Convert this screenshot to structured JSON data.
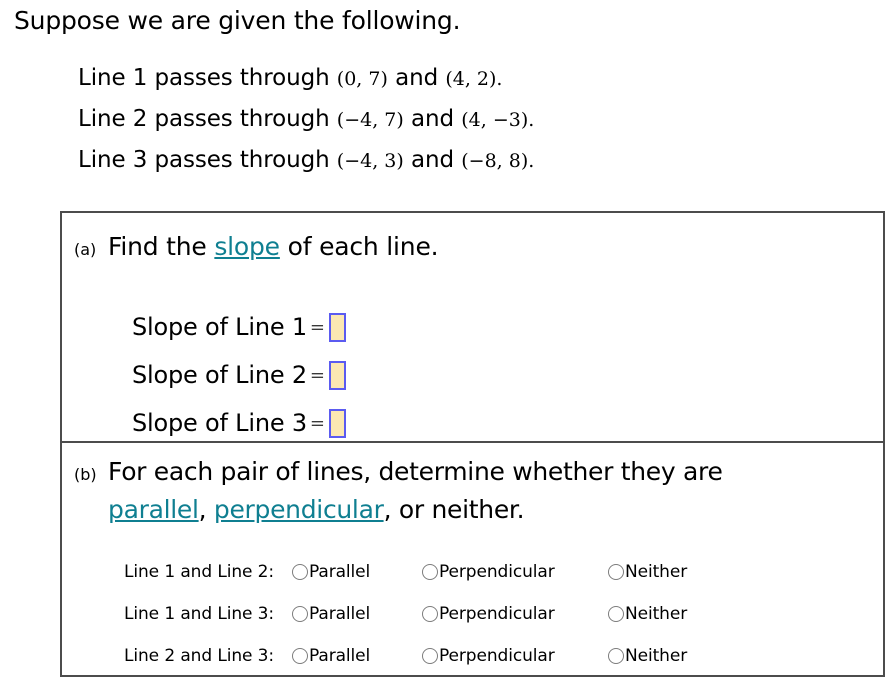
{
  "intro": {
    "text": "Suppose we are given the following."
  },
  "given": [
    {
      "prefix": "Line 1 passes through",
      "point1": "(0, 7)",
      "conjunction": "and",
      "point2": "(4, 2)",
      "period": "."
    },
    {
      "prefix": "Line 2 passes through",
      "point1": "(−4, 7)",
      "conjunction": "and",
      "point2": "(4, −3)",
      "period": "."
    },
    {
      "prefix": "Line 3 passes through",
      "point1": "(−4, 3)",
      "conjunction": "and",
      "point2": "(−8, 8)",
      "period": "."
    }
  ],
  "part_a": {
    "label": "(a)",
    "prompt_before": "Find the ",
    "prompt_link": "slope",
    "prompt_after": " of each line.",
    "equals": "=",
    "rows": [
      {
        "label": "Slope of Line 1",
        "value": ""
      },
      {
        "label": "Slope of Line 2",
        "value": ""
      },
      {
        "label": "Slope of Line 3",
        "value": ""
      }
    ]
  },
  "part_b": {
    "label": "(b)",
    "prompt_line1": "For each pair of lines, determine whether they are",
    "link_parallel": "parallel",
    "comma1": ", ",
    "link_perpendicular": "perpendicular",
    "prompt_tail": ", or neither.",
    "options": {
      "parallel": "Parallel",
      "perpendicular": "Perpendicular",
      "neither": "Neither"
    },
    "rows": [
      {
        "pair": "Line 1 and Line 2:",
        "selected": ""
      },
      {
        "pair": "Line 1 and Line 3:",
        "selected": ""
      },
      {
        "pair": "Line 2 and Line 3:",
        "selected": ""
      }
    ]
  },
  "colors": {
    "link": "#0f7f91",
    "input_fill": "#fce8b2",
    "input_border": "#5b5bf0",
    "box_border": "#4c4c4c"
  }
}
